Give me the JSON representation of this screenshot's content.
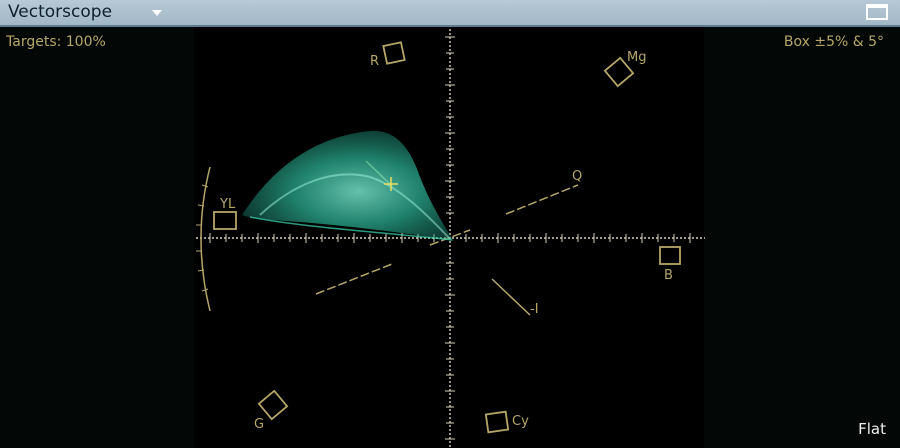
{
  "window": {
    "title": "Vectorscope"
  },
  "overlay": {
    "targets_label": "Targets: 100%",
    "box_tolerance": "Box ±5% & 5°",
    "display_mode": "Flat"
  },
  "targets": {
    "r": "R",
    "mg": "Mg",
    "b": "B",
    "cy": "Cy",
    "g": "G",
    "yl": "YL"
  },
  "axes": {
    "i_line": "-I",
    "q_line": "Q"
  },
  "colors": {
    "graticule": "#b5a66a",
    "trace": "#2fd6b0",
    "titlebar": "#a9bccb"
  }
}
